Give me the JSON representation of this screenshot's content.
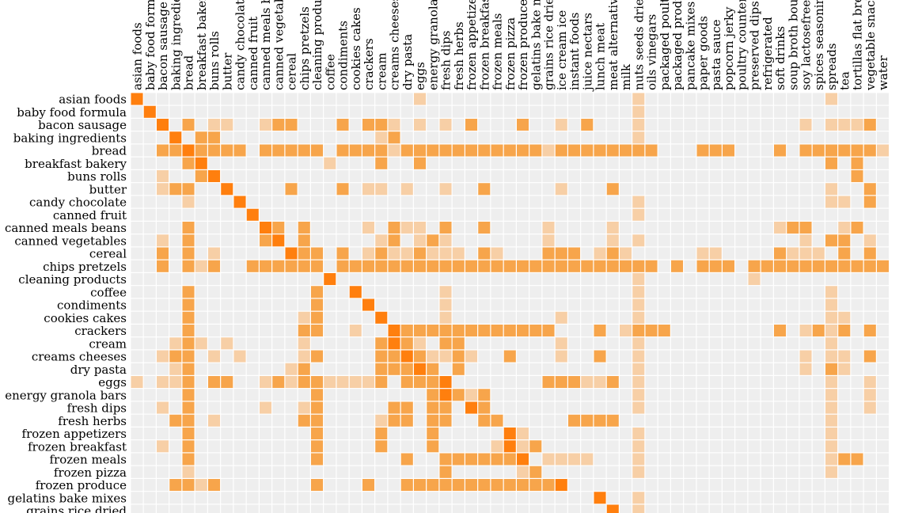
{
  "chart_data": {
    "type": "heatmap",
    "title": "",
    "xlabel": "",
    "ylabel": "",
    "columns": [
      "asian foods",
      "baby food formula",
      "bacon sausage",
      "baking ingredients",
      "bread",
      "breakfast bakery",
      "buns rolls",
      "butter",
      "candy chocolate",
      "canned fruit",
      "canned meals beans",
      "canned vegetables",
      "cereal",
      "chips pretzels",
      "cleaning products",
      "coffee",
      "condiments",
      "cookies cakes",
      "crackers",
      "cream",
      "creams cheeses",
      "dry pasta",
      "eggs",
      "energy granola bars",
      "fresh dips",
      "fresh herbs",
      "frozen appetizers",
      "frozen breakfast",
      "frozen meals",
      "frozen pizza",
      "frozen produce",
      "gelatins bake mixes",
      "grains rice dried",
      "ice cream ice",
      "instant foods",
      "juice nectars",
      "lunch meat",
      "meat alternatives",
      "milk",
      "nuts seeds dried",
      "oils vinegars",
      "packaged poultry",
      "packaged produce",
      "pancake mixes",
      "paper goods",
      "pasta sauce",
      "popcorn jerky",
      "poultry counter",
      "preserved dips",
      "refrigerated",
      "soft drinks",
      "soup broth bouillon",
      "soy lactosefree",
      "spices seasonings",
      "spreads",
      "tea",
      "tortillas flat bread",
      "vegetable snacks",
      "water"
    ],
    "rows": [
      "asian foods",
      "baby food formula",
      "bacon sausage",
      "baking ingredients",
      "bread",
      "breakfast bakery",
      "buns rolls",
      "butter",
      "candy chocolate",
      "canned fruit",
      "canned meals beans",
      "canned vegetables",
      "cereal",
      "chips pretzels",
      "cleaning products",
      "coffee",
      "condiments",
      "cookies cakes",
      "crackers",
      "cream",
      "creams cheeses",
      "dry pasta",
      "eggs",
      "energy granola bars",
      "fresh dips",
      "fresh herbs",
      "frozen appetizers",
      "frozen breakfast",
      "frozen meals",
      "frozen pizza",
      "frozen produce",
      "gelatins bake mixes",
      "grains rice dried"
    ],
    "levels": {
      "0": "none",
      "1": "light",
      "2": "medium",
      "3": "strong (diagonal)"
    },
    "colors": {
      "0": "#eeeeee",
      "1": "#f7cfa6",
      "2": "#f7a54b",
      "3": "#ff7f0e"
    },
    "cells": [
      "300000000000000000000010000000000000000100000000000000100000",
      "030000000000000000000000000000000000000100000000000000000000",
      "003020110012200020221010102000200102000100000000000010111202",
      "000302200000000000012000000000000000000100000000000000000000",
      "002232222022222022221222222222221222222220002220002022222212",
      "000023000000000100020020000000000000000000000000000000202002",
      "001002300000000000000000000000000000000000000000000000002002",
      "001220030000200020110100100200000100020000000000000000100202",
      "000010003000000000000000000000000000000100000000000000110202",
      "000000000300000000000000000000000000000100000000000000000000",
      "000020000032020000102110200200001000010000000000001220012002",
      "001020000023020000012012100000001000010100000000000010220102",
      "002020100000322020121121110210002220121000001100002111020202",
      "002021200222222022222222222222222222222220202220222222222222",
      "000000000000000300000000000000000000000100000000100000000000",
      "000020000000002003000000100000000000000100000000000000100002",
      "000020000000002000300000100000000000000100000000000000100002",
      "000020000000012000030000100000000100000100000000000000110002",
      "000020000000022001003222222222222000201222000000002012120202",
      "000121010000010000023210220000000100000100000000000000100002",
      "001220101000012000022321121002000100200100000000000010110202",
      "000120000000120000022232020000000000000100000000000010210002",
      "101120220012122111120222300000002221120100000000000000100102",
      "000020000000002000000002321200000000000100000000000000100102",
      "001020000010012000002202203200000000000100000000000000100102",
      "000220100000022000012202200220000022220000000000000000100002",
      "000020000000002000020002000003100000000100000000000000100002",
      "001020000000002000020002000013120000000100000000000000100002",
      "000020000000002000000200222222301111000100000000000000122002",
      "000010000000000000000000200000120000000100000000000000100002",
      "000221200000002000200222222222222300000000000000000000000000",
      "000000000000000000000000000000000000300100000000000000000000",
      "000000000000000000000000000000000000030100000000000000000000"
    ]
  }
}
